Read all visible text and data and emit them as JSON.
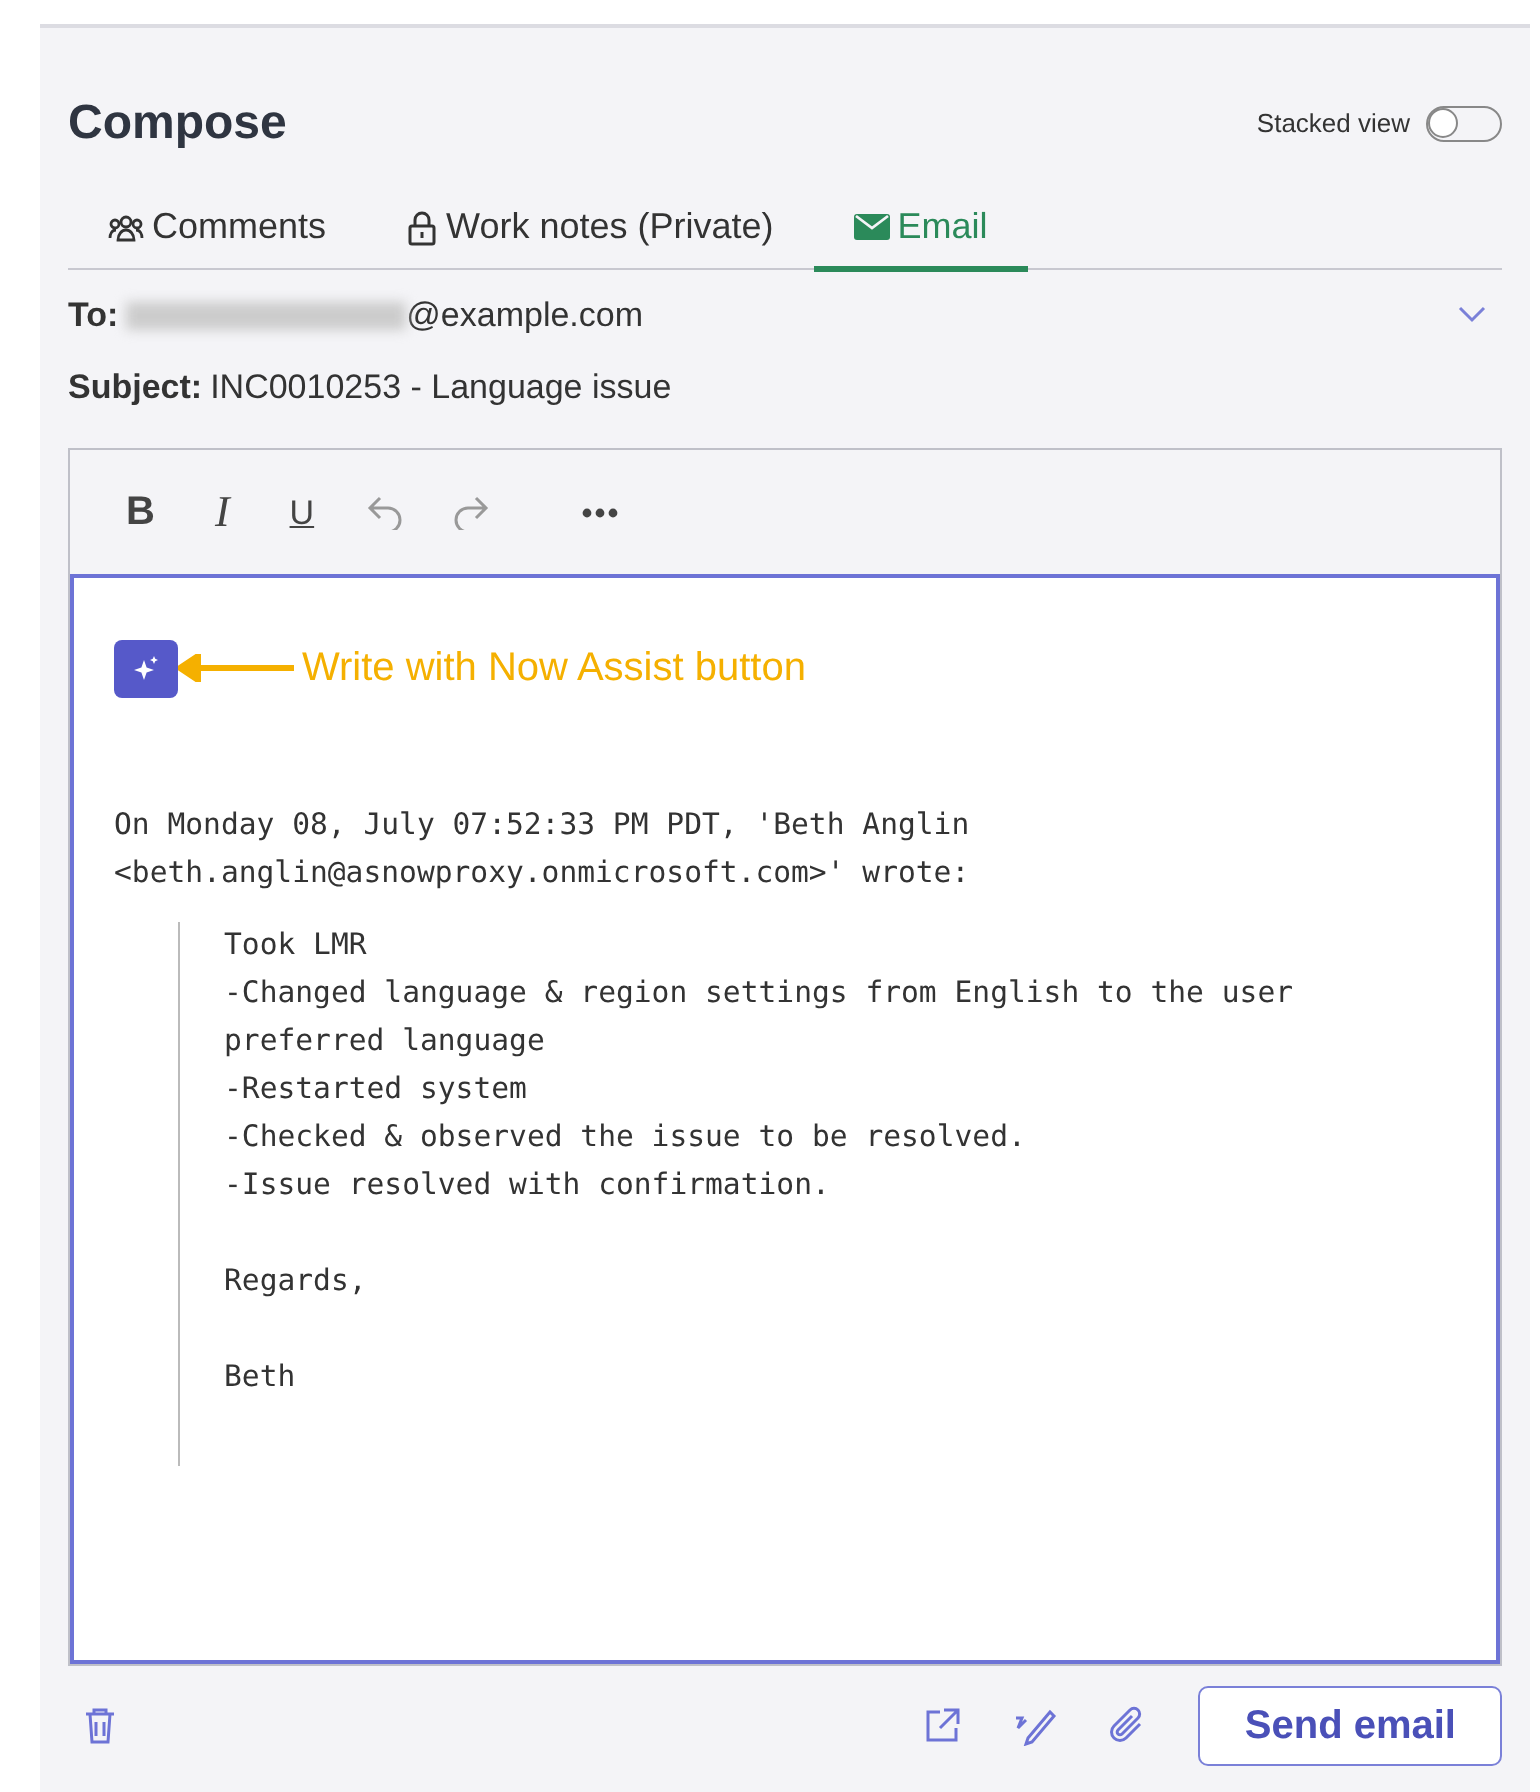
{
  "title": "Compose",
  "stacked_view": {
    "label": "Stacked view",
    "on": false
  },
  "tabs": [
    {
      "label": "Comments",
      "selected": false
    },
    {
      "label": "Work notes (Private)",
      "selected": false
    },
    {
      "label": "Email",
      "selected": true
    }
  ],
  "to": {
    "label": "To:",
    "value": "@example.com"
  },
  "subject": {
    "label": "Subject:",
    "value": "INC0010253 - Language issue"
  },
  "toolbar": [
    {
      "kind": "bold",
      "label": "B"
    },
    {
      "kind": "italic",
      "label": "I"
    },
    {
      "kind": "underline",
      "label": "U"
    },
    {
      "kind": "undo"
    },
    {
      "kind": "redo"
    },
    {
      "kind": "more"
    }
  ],
  "annotation": {
    "text": "Write with Now Assist button"
  },
  "body": {
    "intro": [
      "On Monday 08, July 07:52:33 PM PDT, 'Beth Anglin",
      "<beth.anglin@asnowproxy.onmicrosoft.com>' wrote:"
    ],
    "quote": [
      [
        "Took LMR",
        "-Changed language & region settings from English to the user",
        "preferred language",
        "-Restarted system",
        "-Checked & observed the issue to be resolved.",
        "-Issue resolved with confirmation."
      ],
      [
        "Regards,"
      ],
      [
        "Beth"
      ]
    ]
  },
  "footer": {
    "send": "Send email"
  }
}
